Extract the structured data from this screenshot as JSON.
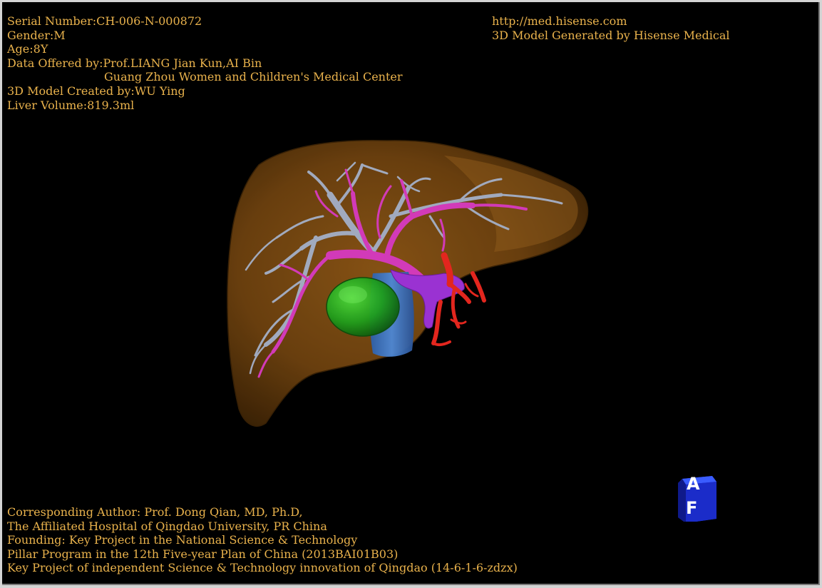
{
  "header_left": {
    "serial": "Serial Number:CH-006-N-000872",
    "gender": "Gender:M",
    "age": "Age:8Y",
    "data_offered": "Data Offered by:Prof.LIANG Jian Kun,AI Bin",
    "institution": "Guang Zhou Women and Children's Medical Center",
    "model_created": "3D Model Created by:WU Ying",
    "liver_volume": "Liver Volume:819.3ml"
  },
  "header_right": {
    "url": "http://med.hisense.com",
    "generator": "3D Model Generated by Hisense Medical"
  },
  "footer": {
    "author": "Corresponding Author: Prof. Dong Qian, MD, Ph.D,",
    "hospital": "The Affiliated Hospital of Qingdao University, PR China",
    "founding": "Founding: Key Project in the National Science & Technology",
    "program": "Pillar Program in the 12th Five-year Plan of China (2013BAI01B03)",
    "project": "Key Project of independent Science & Technology innovation of Qingdao (14-6-1-6-zdzx)"
  },
  "orientation_cube": {
    "top_label": "A",
    "front_label": "F",
    "color": "#1c2fd8"
  },
  "colors": {
    "background": "#000000",
    "text": "#e9b24c",
    "liver": "#7a4a12",
    "hepatic_vein": "#9aa6bf",
    "portal_vein": "#d53ab6",
    "hepatic_artery": "#e0241c",
    "tumor": "#1fa31f",
    "ivc": "#3c74c0",
    "bile_duct": "#9a2fd0"
  }
}
